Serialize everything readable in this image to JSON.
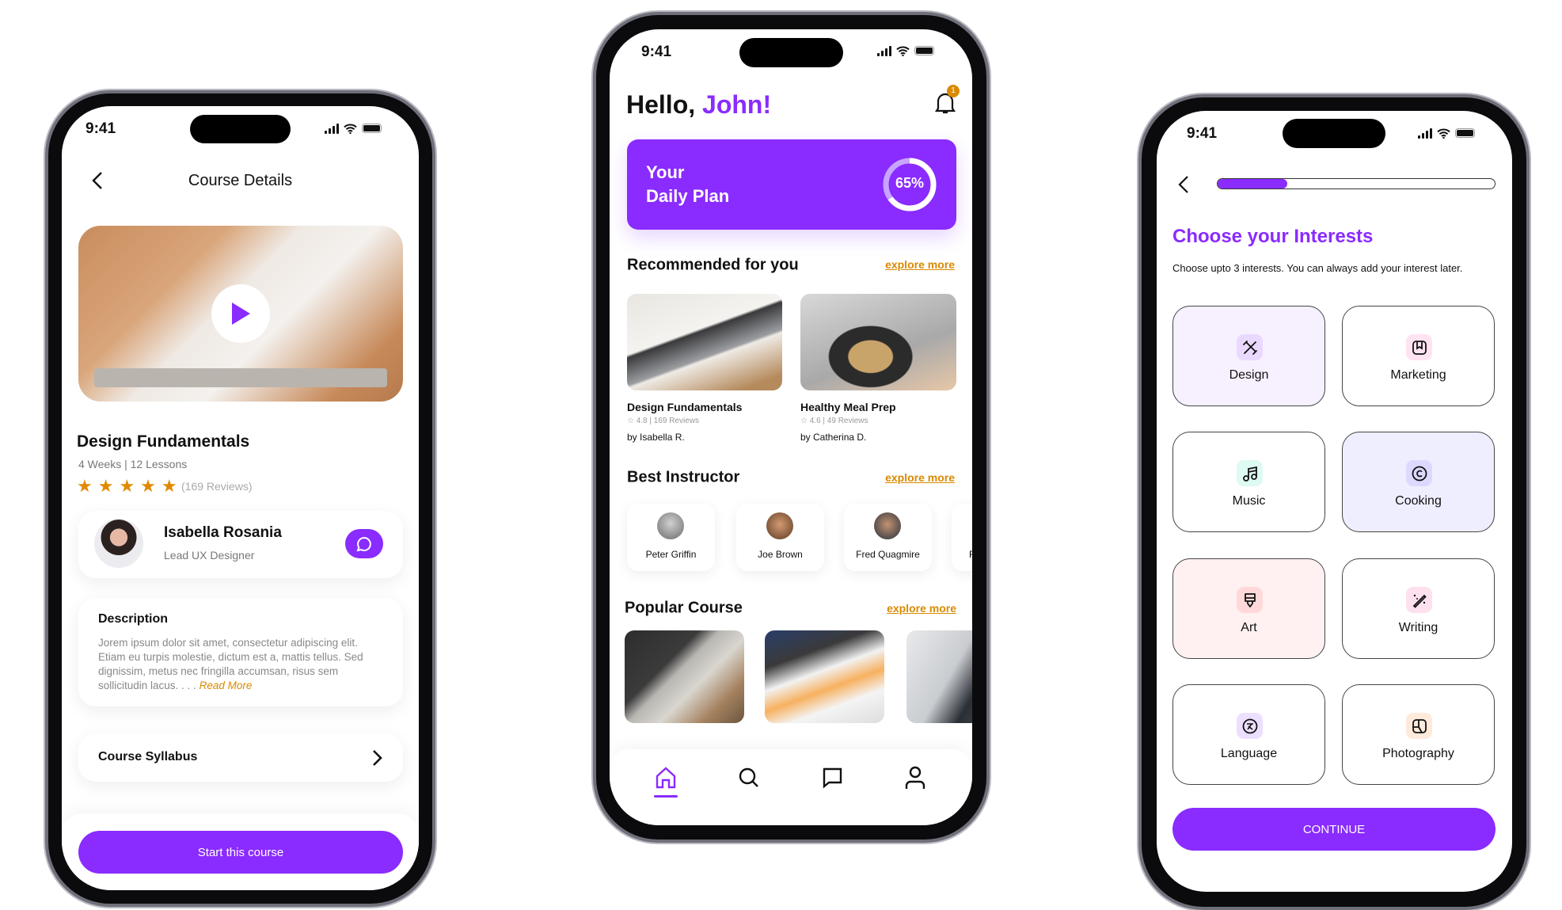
{
  "colors": {
    "accent": "#8a2bff",
    "link": "#d98a00",
    "star": "#e08a00"
  },
  "status_time": "9:41",
  "course_details": {
    "header_title": "Course Details",
    "course_title": "Design Fundamentals",
    "meta": "4 Weeks | 12 Lessons",
    "rating_stars": 5,
    "reviews": "(169 Reviews)",
    "instructor": {
      "name": "Isabella Rosania",
      "role": "Lead UX Designer"
    },
    "description_title": "Description",
    "description_text": "Jorem ipsum dolor sit amet, consectetur adipiscing elit. Etiam eu turpis molestie, dictum est a, mattis tellus. Sed dignissim, metus nec fringilla accumsan, risus sem sollicitudin lacus. . . .",
    "read_more": "Read More",
    "syllabus_label": "Course Syllabus",
    "start_button": "Start this course"
  },
  "home": {
    "greeting": "Hello,",
    "user_name": "John!",
    "notification_count": "1",
    "plan": {
      "line1": "Your",
      "line2": "Daily Plan",
      "progress_label": "65%",
      "progress": 65
    },
    "recommended": {
      "title": "Recommended for you",
      "explore": "explore more",
      "items": [
        {
          "title": "Design Fundamentals",
          "rating": "4.8 | 169 Reviews",
          "author": "by Isabella R."
        },
        {
          "title": "Healthy Meal Prep",
          "rating": "4.6 | 49 Reviews",
          "author": "by Catherina D."
        }
      ]
    },
    "instructors": {
      "title": "Best Instructor",
      "explore": "explore more",
      "items": [
        {
          "name": "Peter Griffin"
        },
        {
          "name": "Joe Brown"
        },
        {
          "name": "Fred Quagmire"
        },
        {
          "name": "F"
        }
      ]
    },
    "popular": {
      "title": "Popular Course",
      "explore": "explore more"
    },
    "nav": [
      {
        "icon": "home-icon",
        "active": true
      },
      {
        "icon": "search-icon"
      },
      {
        "icon": "chat-icon"
      },
      {
        "icon": "profile-icon"
      }
    ]
  },
  "interests": {
    "progress": 25,
    "title": "Choose your Interests",
    "subtitle": "Choose upto 3 interests. You can always add your interest later.",
    "items": [
      {
        "label": "Design",
        "icon": "design-tools-icon",
        "bg": "#f7f0ff",
        "icon_bg": "#ead9ff"
      },
      {
        "label": "Marketing",
        "icon": "marketing-icon",
        "bg": "#ffffff",
        "icon_bg": "#ffe3f3"
      },
      {
        "label": "Music",
        "icon": "music-note-icon",
        "bg": "#ffffff",
        "icon_bg": "#ddfaf3"
      },
      {
        "label": "Cooking",
        "icon": "copyright-circle-icon",
        "bg": "#efeeff",
        "icon_bg": "#dcd9ff"
      },
      {
        "label": "Art",
        "icon": "paint-brush-icon",
        "bg": "#fff1f1",
        "icon_bg": "#ffd9d9"
      },
      {
        "label": "Writing",
        "icon": "magic-pen-icon",
        "bg": "#ffffff",
        "icon_bg": "#ffe0ee"
      },
      {
        "label": "Language",
        "icon": "translate-icon",
        "bg": "#ffffff",
        "icon_bg": "#eddfff"
      },
      {
        "label": "Photography",
        "icon": "gallery-icon",
        "bg": "#ffffff",
        "icon_bg": "#ffeadb"
      }
    ],
    "continue_button": "CONTINUE"
  }
}
